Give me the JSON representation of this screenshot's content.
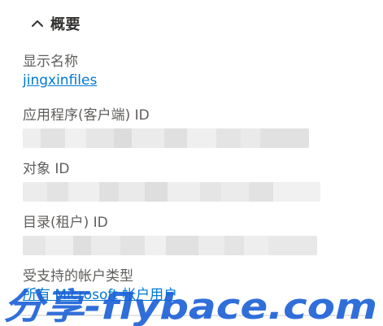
{
  "section": {
    "title": "概要",
    "icon": "chevron-up-icon"
  },
  "fields": {
    "display_name": {
      "label": "显示名称",
      "value": "jingxinfiles"
    },
    "client_id": {
      "label": "应用程序(客户端) ID"
    },
    "object_id": {
      "label": "对象 ID"
    },
    "tenant_id": {
      "label": "目录(租户) ID"
    },
    "account_types": {
      "label": "受支持的帐户类型",
      "value": "所有 Microsoft 帐户用户"
    }
  },
  "watermark": {
    "text": "分享-flybace.com",
    "color": "#1a5fd6"
  },
  "colors": {
    "link": "#0078d4",
    "label": "#605e5c",
    "title": "#323130"
  }
}
